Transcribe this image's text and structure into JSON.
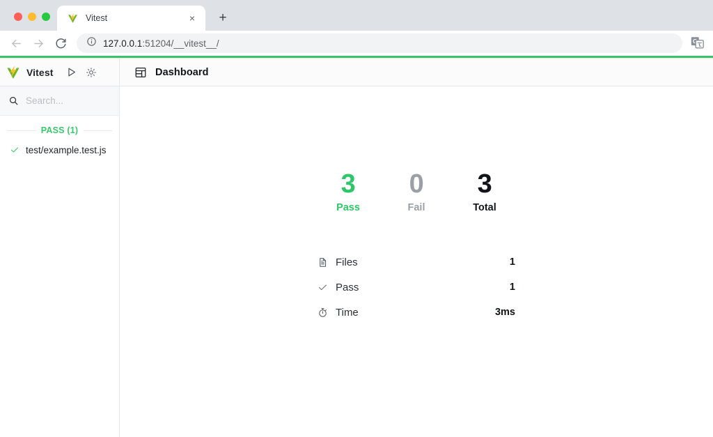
{
  "browser": {
    "traffic_lights": [
      {
        "name": "close",
        "color": "#ff5f57"
      },
      {
        "name": "minimize",
        "color": "#febc2e"
      },
      {
        "name": "maximize",
        "color": "#28c840"
      }
    ],
    "tab": {
      "title": "Vitest",
      "favicon": "vitest-logo-icon",
      "close_label": "×"
    },
    "new_tab_label": "+",
    "nav": {
      "back": "back-arrow-icon",
      "forward": "forward-arrow-icon",
      "reload": "reload-icon"
    },
    "omnibox": {
      "info_icon": "info-circle-icon",
      "host": "127.0.0.1",
      "rest": ":51204/__vitest__/",
      "full_url": "127.0.0.1:51204/__vitest__/"
    },
    "translate_icon": "translate-icon"
  },
  "app": {
    "progress_color": "#39c46a",
    "header": {
      "brand": "Vitest",
      "logo_icon": "vitest-logo-icon",
      "run_icon": "play-icon",
      "theme_icon": "sun-icon",
      "view_icon": "dashboard-layout-icon",
      "view_title": "Dashboard"
    },
    "sidebar": {
      "search": {
        "icon": "search-icon",
        "placeholder": "Search...",
        "value": ""
      },
      "groups": [
        {
          "label": "PASS (1)",
          "color": "#36c96a",
          "files": [
            {
              "name": "test/example.test.js",
              "status": "pass",
              "icon": "check-icon"
            }
          ]
        }
      ]
    },
    "dashboard": {
      "stats": [
        {
          "key": "pass",
          "value": "3",
          "label": "Pass",
          "color": "#2fc66b"
        },
        {
          "key": "fail",
          "value": "0",
          "label": "Fail",
          "color": "#9aa0a6"
        },
        {
          "key": "total",
          "value": "3",
          "label": "Total",
          "color": "#111418"
        }
      ],
      "details": [
        {
          "icon": "file-icon",
          "label": "Files",
          "value": "1"
        },
        {
          "icon": "check-icon",
          "label": "Pass",
          "value": "1"
        },
        {
          "icon": "timer-icon",
          "label": "Time",
          "value": "3ms"
        }
      ]
    }
  }
}
